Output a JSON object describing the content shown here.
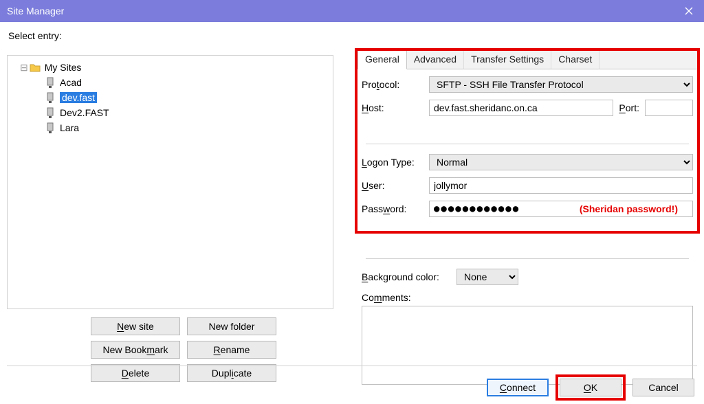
{
  "window": {
    "title": "Site Manager"
  },
  "left": {
    "select_label": "Select entry:",
    "root": "My Sites",
    "items": [
      "Acad",
      "dev.fast",
      "Dev2.FAST",
      "Lara"
    ],
    "selected": "dev.fast",
    "buttons": {
      "new_site": "New site",
      "new_folder": "New folder",
      "new_bookmark": "New Bookmark",
      "rename": "Rename",
      "delete": "Delete",
      "duplicate": "Duplicate"
    }
  },
  "tabs": [
    "General",
    "Advanced",
    "Transfer Settings",
    "Charset"
  ],
  "form": {
    "protocol_label": "Protocol:",
    "protocol_value": "SFTP - SSH File Transfer Protocol",
    "host_label": "Host:",
    "host_value": "dev.fast.sheridanc.on.ca",
    "port_label": "Port:",
    "port_value": "",
    "logon_label": "Logon Type:",
    "logon_value": "Normal",
    "user_label": "User:",
    "user_value": "jollymor",
    "password_label": "Password:",
    "password_value": "●●●●●●●●●●●●",
    "password_annotation": "(Sheridan password!)",
    "bg_label": "Background color:",
    "bg_value": "None",
    "comments_label": "Comments:",
    "comments_value": ""
  },
  "bottom": {
    "connect": "Connect",
    "ok": "OK",
    "cancel": "Cancel"
  }
}
